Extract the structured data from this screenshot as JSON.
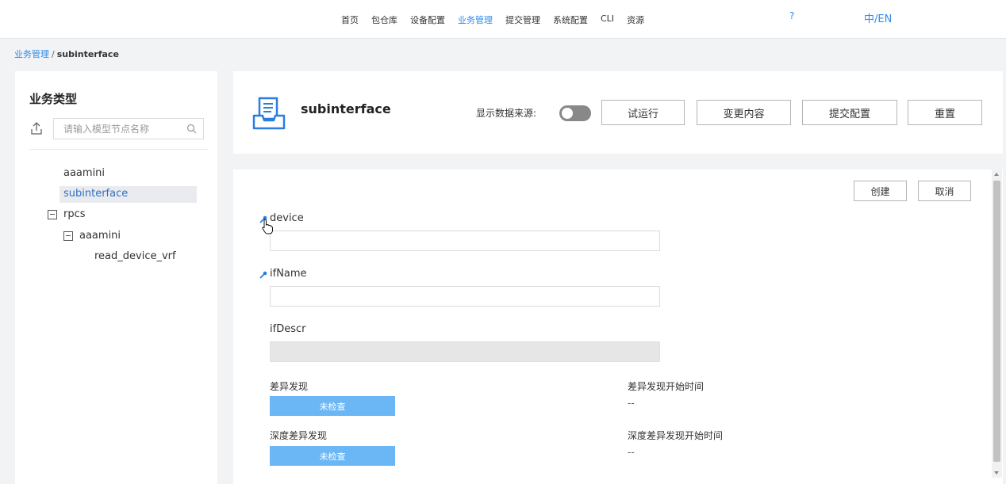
{
  "nav": {
    "items": [
      {
        "label": "首页",
        "active": false
      },
      {
        "label": "包仓库",
        "active": false
      },
      {
        "label": "设备配置",
        "active": false
      },
      {
        "label": "业务管理",
        "active": true
      },
      {
        "label": "提交管理",
        "active": false
      },
      {
        "label": "系统配置",
        "active": false
      },
      {
        "label": "CLI",
        "active": false
      },
      {
        "label": "资源",
        "active": false
      }
    ],
    "help": "?",
    "lang": "中/EN"
  },
  "breadcrumb": {
    "parent": "业务管理",
    "separator": "/",
    "current": "subinterface"
  },
  "sidebar": {
    "title": "业务类型",
    "search_placeholder": "请输入模型节点名称",
    "tree": [
      {
        "label": "aaamini",
        "selected": false
      },
      {
        "label": "subinterface",
        "selected": true
      },
      {
        "label": "rpcs",
        "selected": false
      },
      {
        "label": "aaamini",
        "selected": false
      },
      {
        "label": "read_device_vrf",
        "selected": false
      }
    ]
  },
  "header": {
    "title": "subinterface",
    "datasource_label": "显示数据来源:",
    "datasource_on": false,
    "buttons": [
      "试运行",
      "变更内容",
      "提交配置",
      "重置"
    ]
  },
  "form": {
    "create_label": "创建",
    "cancel_label": "取消",
    "fields": [
      {
        "label": "device",
        "key": true,
        "value": "",
        "disabled": false
      },
      {
        "label": "ifName",
        "key": true,
        "value": "",
        "disabled": false
      },
      {
        "label": "ifDescr",
        "key": false,
        "value": "",
        "disabled": true
      }
    ],
    "diff": {
      "label": "差异发现",
      "status": "未检查",
      "start_label": "差异发现开始时间",
      "start_value": "--"
    },
    "deep_diff": {
      "label": "深度差异发现",
      "status": "未检查",
      "start_label": "深度差异发现开始时间",
      "start_value": "--"
    }
  },
  "colors": {
    "accent": "#2f8be8",
    "status_button": "#6bb7f5",
    "toggle_off": "#888888"
  },
  "icons": {
    "upload": "upload-icon",
    "search": "search-icon",
    "model": "model-tray-icon",
    "key": "key-icon",
    "collapse": "minus-box-icon"
  }
}
